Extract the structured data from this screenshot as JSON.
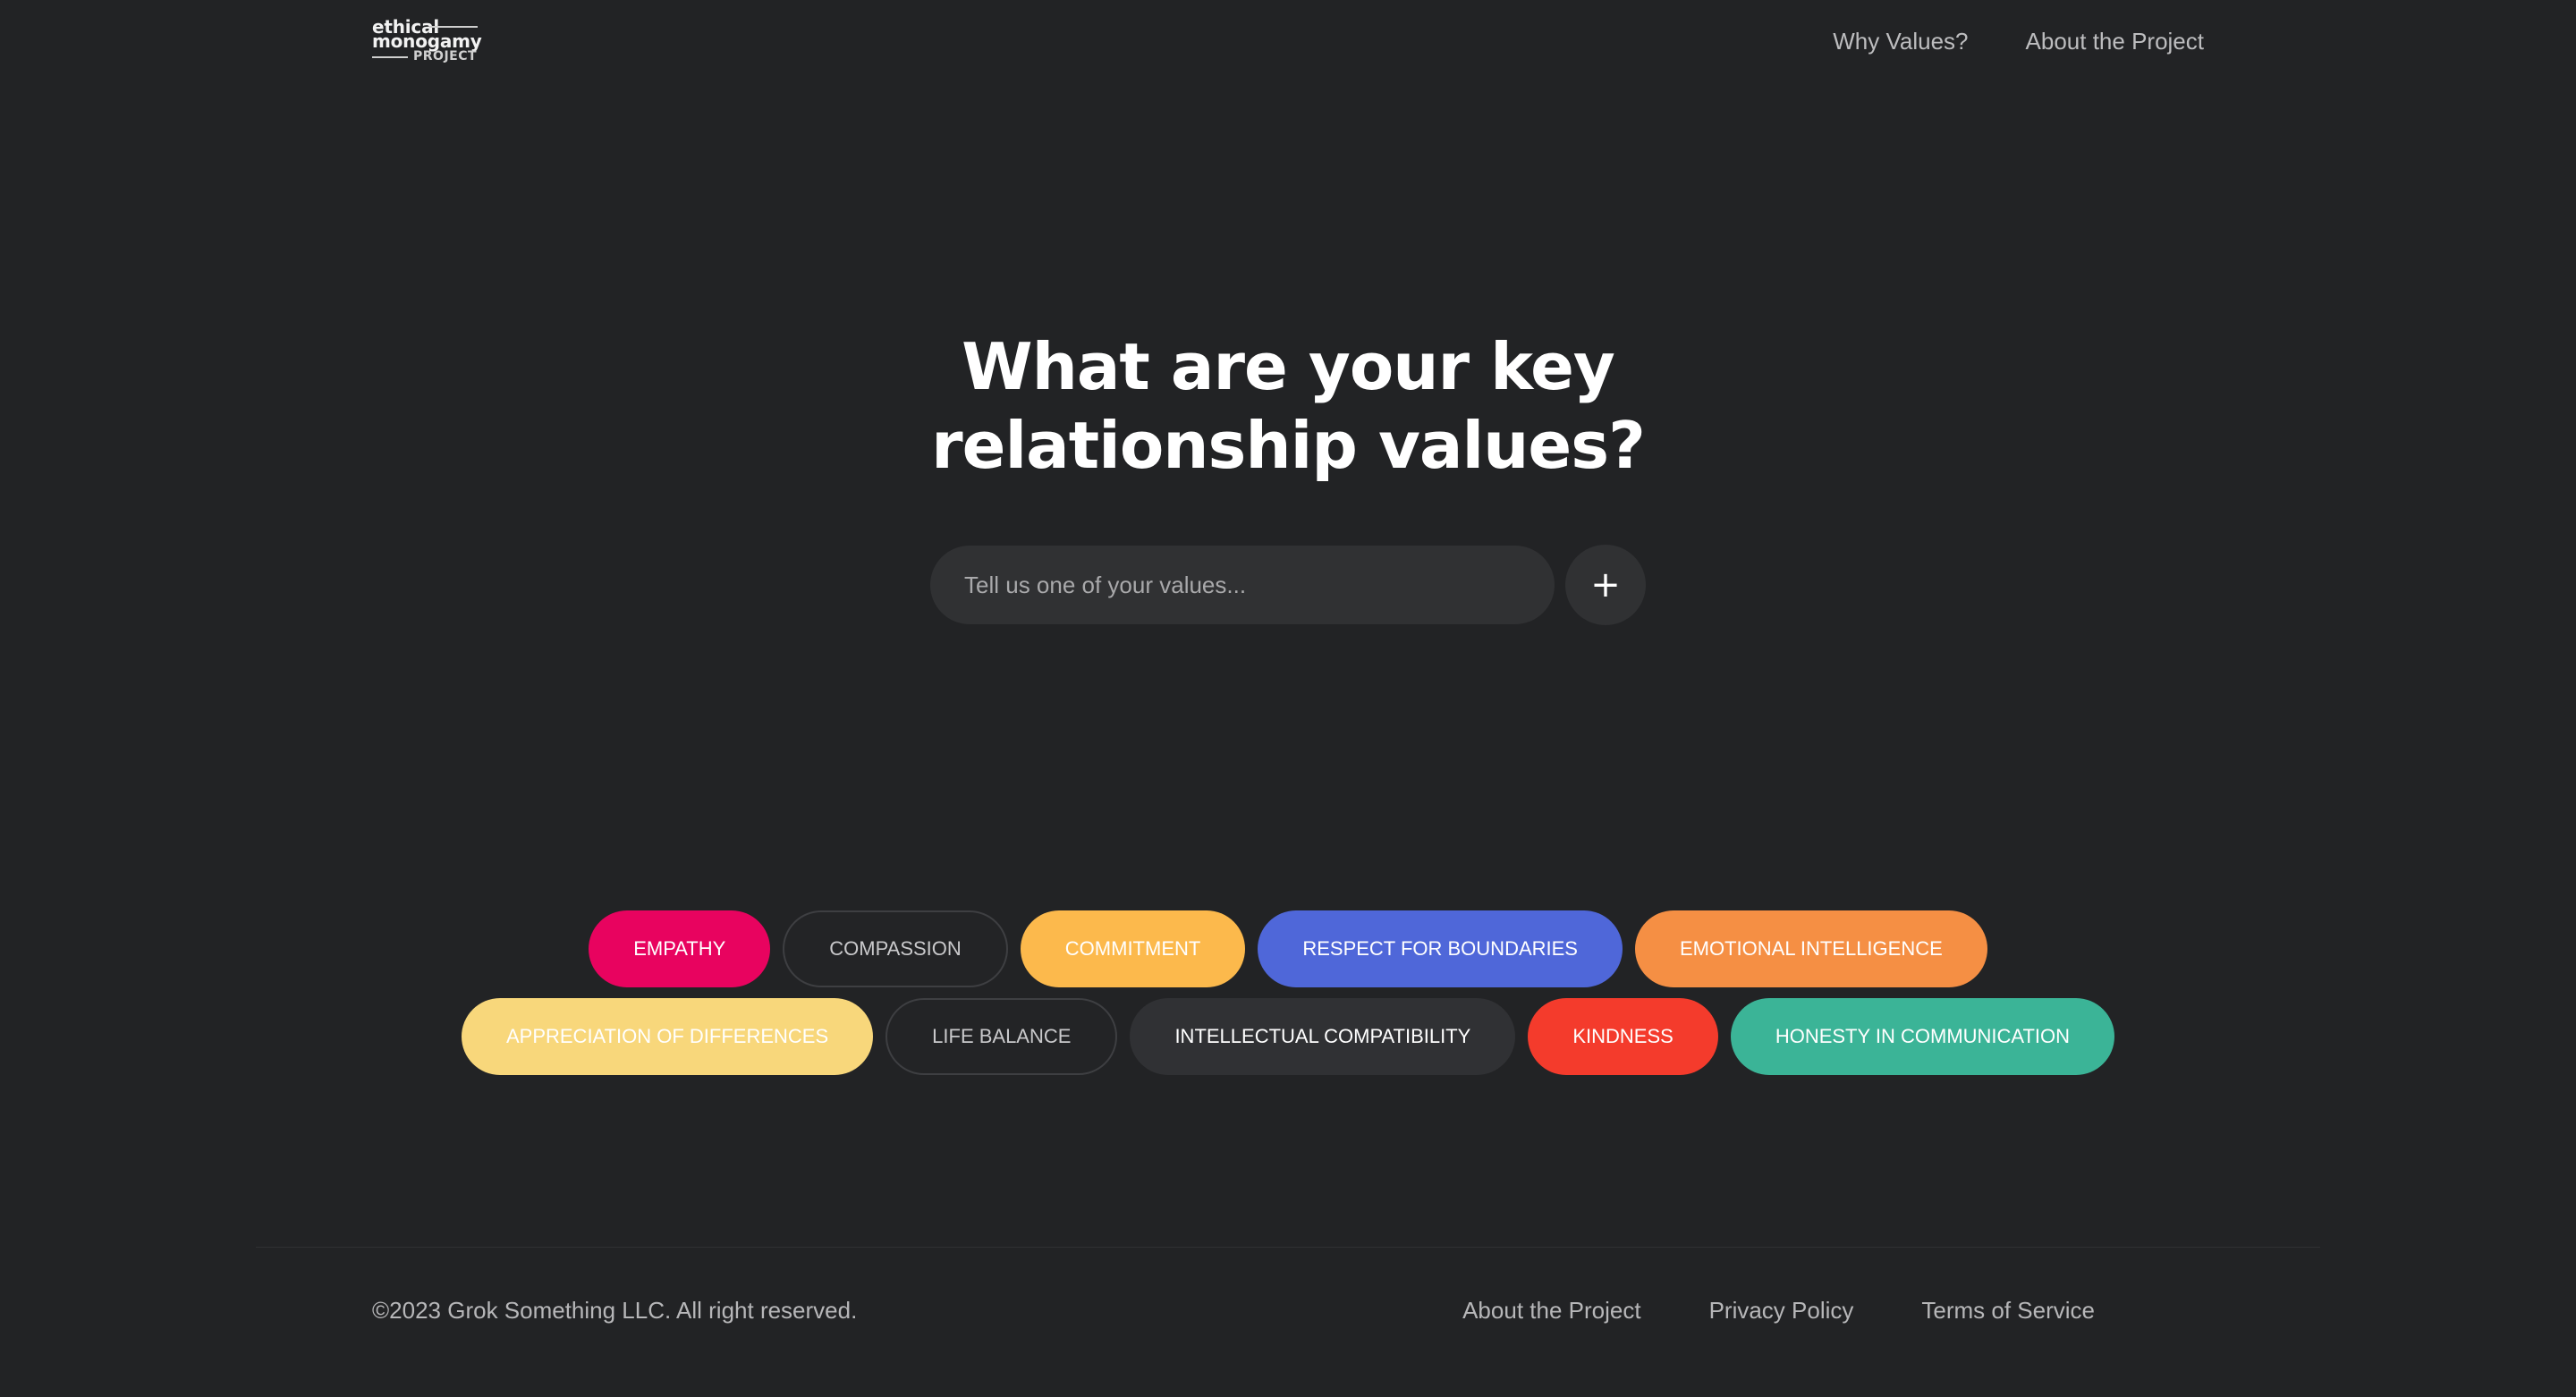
{
  "header": {
    "logo": {
      "line1": "ethical",
      "line2": "monogamy",
      "line3": "PROJECT"
    },
    "nav": [
      {
        "label": "Why Values?"
      },
      {
        "label": "About the Project"
      }
    ]
  },
  "hero": {
    "title_line1": "What are your key",
    "title_line2": "relationship values?"
  },
  "search": {
    "placeholder": "Tell us one of your values...",
    "add_icon": "plus-icon",
    "add_label": "+"
  },
  "tags": {
    "rows": [
      [
        {
          "label": "EMPATHY",
          "bg": "#e8035f",
          "fg": "#ffffff",
          "border": "none"
        },
        {
          "label": "COMPASSION",
          "bg": "#232426",
          "fg": "#c9c9cb",
          "border": "#3e3f42"
        },
        {
          "label": "COMMITMENT",
          "bg": "#fcb94c",
          "fg": "#ffffff",
          "border": "none"
        },
        {
          "label": "RESPECT FOR BOUNDARIES",
          "bg": "#4f67d9",
          "fg": "#ffffff",
          "border": "none"
        },
        {
          "label": "EMOTIONAL INTELLIGENCE",
          "bg": "#f58f44",
          "fg": "#ffffff",
          "border": "none"
        }
      ],
      [
        {
          "label": "APPRECIATION OF DIFFERENCES",
          "bg": "#f8d77b",
          "fg": "#ffffff",
          "border": "none"
        },
        {
          "label": "LIFE BALANCE",
          "bg": "#232426",
          "fg": "#c9c9cb",
          "border": "#3e3f42"
        },
        {
          "label": "INTELLECTUAL COMPATIBILITY",
          "bg": "#303134",
          "fg": "#ffffff",
          "border": "none"
        },
        {
          "label": "KINDNESS",
          "bg": "#f43b2c",
          "fg": "#ffffff",
          "border": "none"
        },
        {
          "label": "HONESTY IN COMMUNICATION",
          "bg": "#3bb497",
          "fg": "#ffffff",
          "border": "none"
        }
      ]
    ]
  },
  "footer": {
    "copyright": "©2023 Grok Something LLC. All right reserved.",
    "links": [
      {
        "label": "About the Project"
      },
      {
        "label": "Privacy Policy"
      },
      {
        "label": "Terms of Service"
      }
    ]
  }
}
